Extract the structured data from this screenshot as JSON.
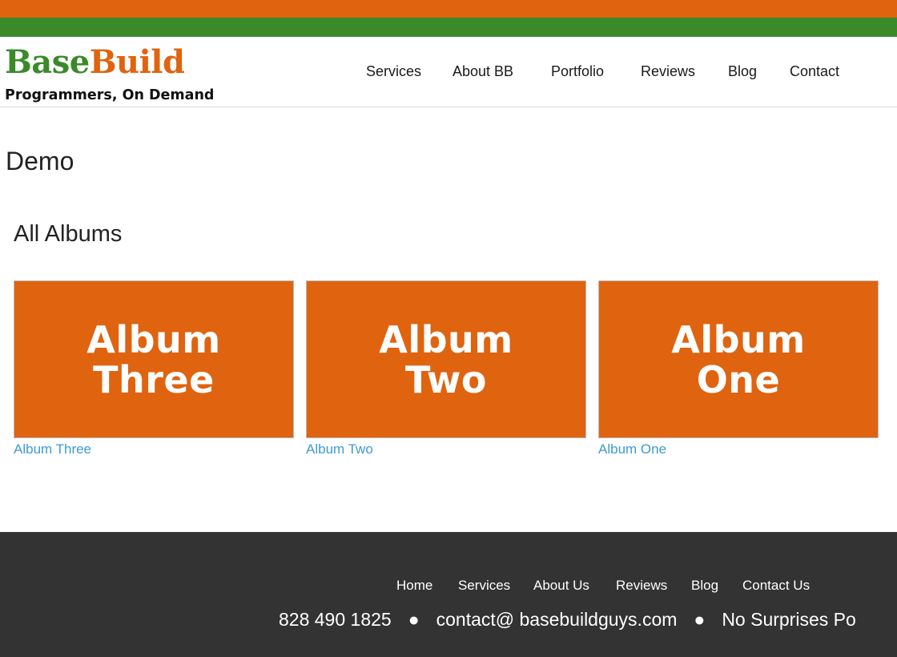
{
  "logo": {
    "part1": "Base",
    "part2": "Build",
    "tagline": "Programmers, On Demand"
  },
  "nav": [
    "Services",
    "About BB",
    "Portfolio",
    "Reviews",
    "Blog",
    "Contact"
  ],
  "page": {
    "title": "Demo",
    "section_title": "All Albums"
  },
  "albums": [
    {
      "thumb_line1": "Album",
      "thumb_line2": "Three",
      "label": "Album Three"
    },
    {
      "thumb_line1": "Album",
      "thumb_line2": "Two",
      "label": "Album Two"
    },
    {
      "thumb_line1": "Album",
      "thumb_line2": "One",
      "label": "Album One"
    }
  ],
  "footer": {
    "links": [
      "Home",
      "Services",
      "About Us",
      "Reviews",
      "Blog",
      "Contact Us"
    ],
    "phone": "828 490 1825",
    "email": "contact@ basebuildguys.com",
    "tagline": "No Surprises Po"
  },
  "colors": {
    "orange": "#e0630f",
    "green": "#3a8a2a",
    "footer_bg": "#333333",
    "link": "#3d9bd1"
  }
}
